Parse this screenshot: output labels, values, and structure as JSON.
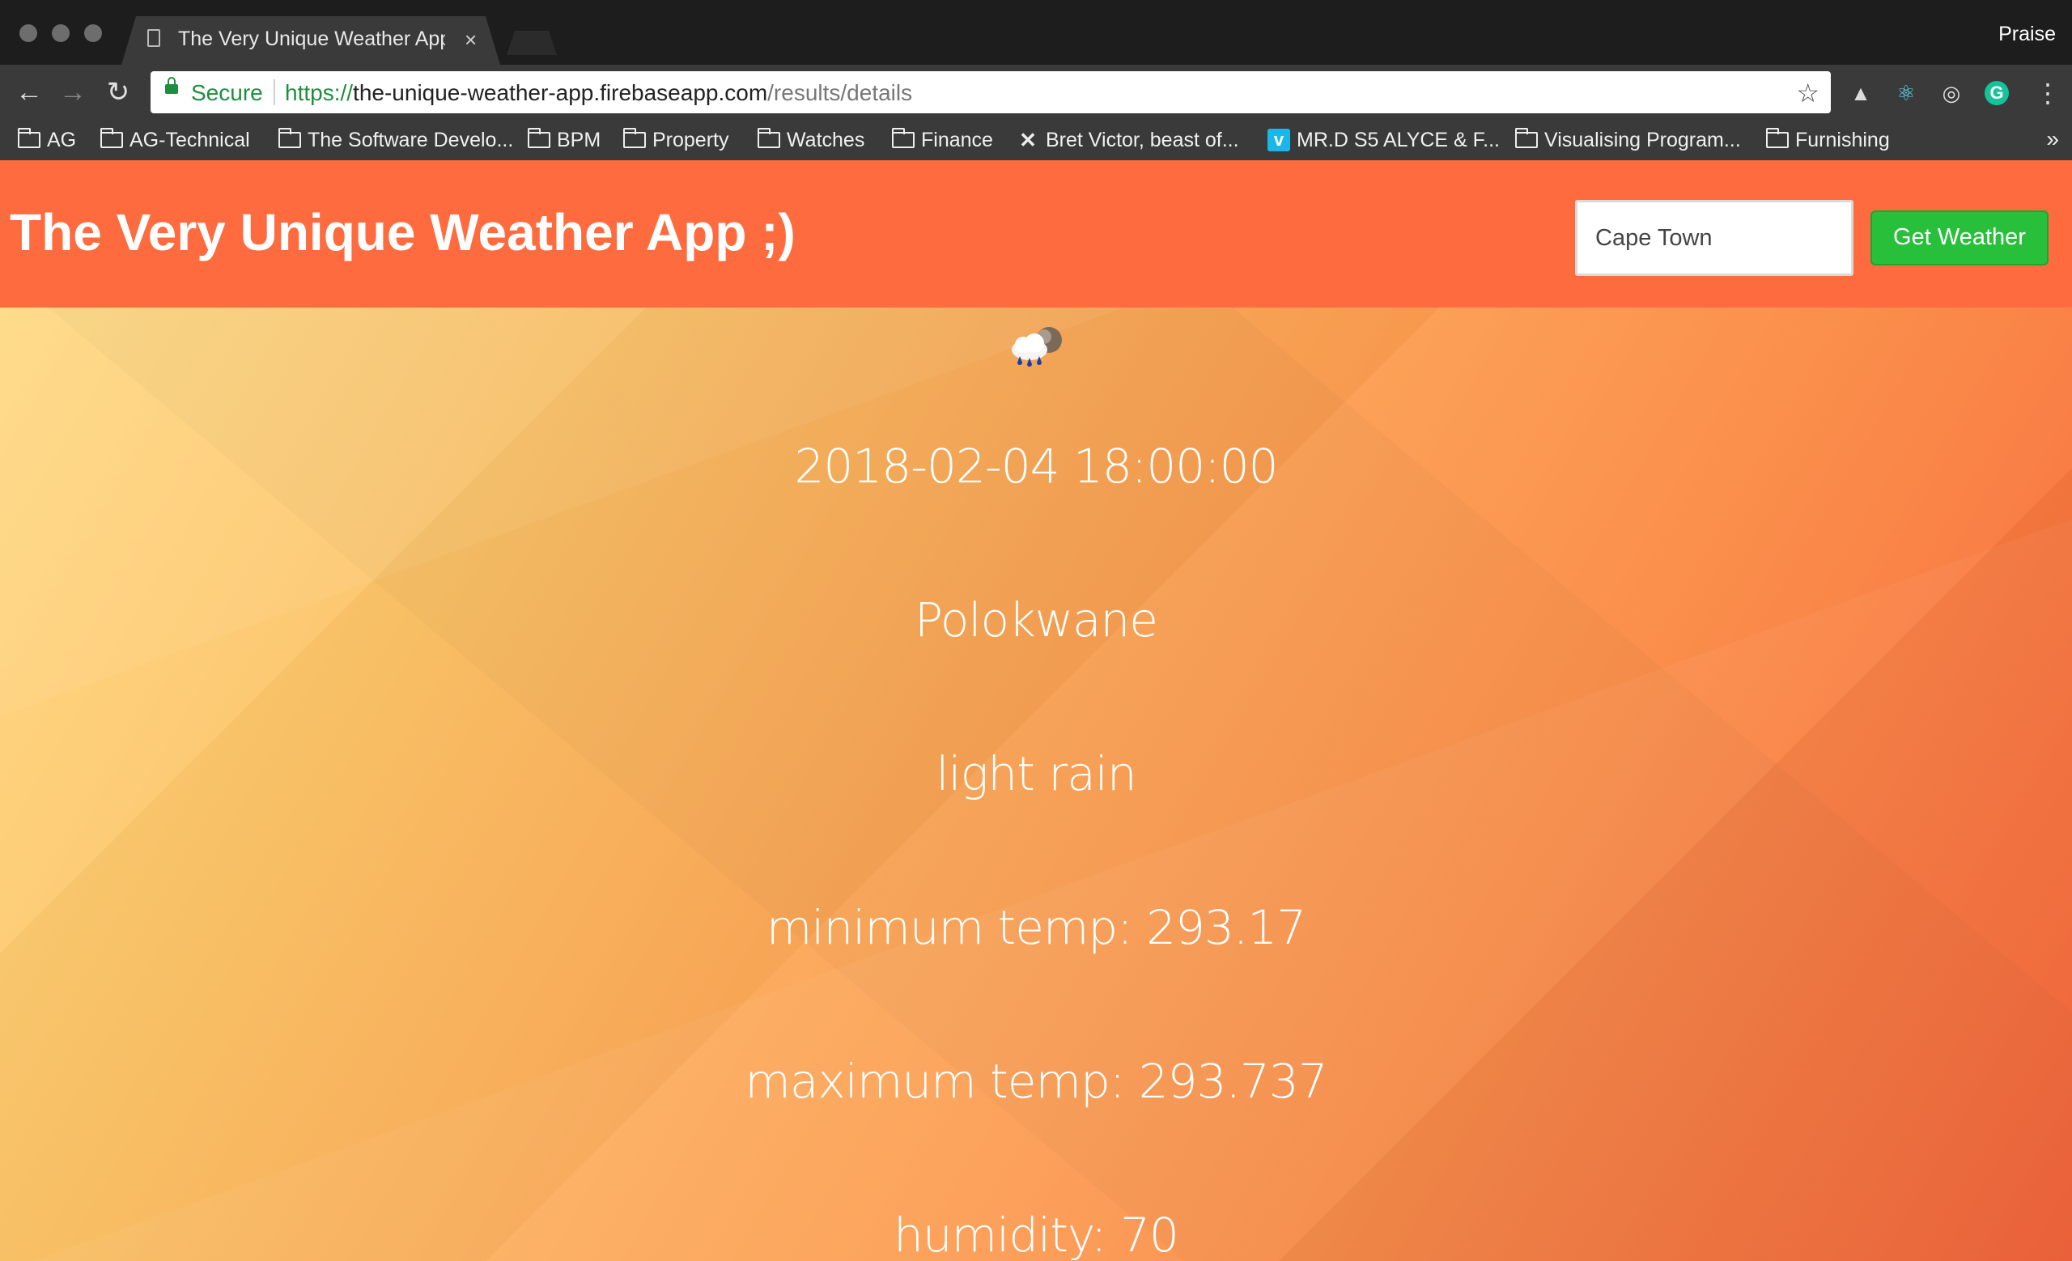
{
  "browser": {
    "tab_title": "The Very Unique Weather App",
    "profile_name": "Praise",
    "secure_label": "Secure",
    "url_scheme": "https://",
    "url_host": "the-unique-weather-app.firebaseapp.com",
    "url_path": "/results/details",
    "bookmarks": [
      {
        "label": "AG",
        "icon": "folder-icon"
      },
      {
        "label": "AG-Technical",
        "icon": "folder-icon"
      },
      {
        "label": "The Software Develo...",
        "icon": "folder-icon"
      },
      {
        "label": "BPM",
        "icon": "folder-icon"
      },
      {
        "label": "Property",
        "icon": "folder-icon"
      },
      {
        "label": "Watches",
        "icon": "folder-icon"
      },
      {
        "label": "Finance",
        "icon": "folder-icon"
      },
      {
        "label": "Bret Victor, beast of...",
        "icon": "bret-victor-icon"
      },
      {
        "label": "MR.D S5 ALYCE & F...",
        "icon": "vimeo-icon"
      },
      {
        "label": "Visualising Program...",
        "icon": "folder-icon"
      },
      {
        "label": "Furnishing",
        "icon": "folder-icon"
      }
    ]
  },
  "app": {
    "title": "The Very Unique Weather App ;)",
    "search_value": "Cape Town",
    "button_label": "Get Weather",
    "header_color": "#fe6b3f",
    "button_color": "#28c03a"
  },
  "weather": {
    "icon": "light-rain-icon",
    "datetime": "2018-02-04 18:00:00",
    "city": "Polokwane",
    "description": "light rain",
    "min_temp": "minimum temp: 293.17",
    "max_temp": "maximum temp: 293.737",
    "humidity": "humidity: 70"
  }
}
